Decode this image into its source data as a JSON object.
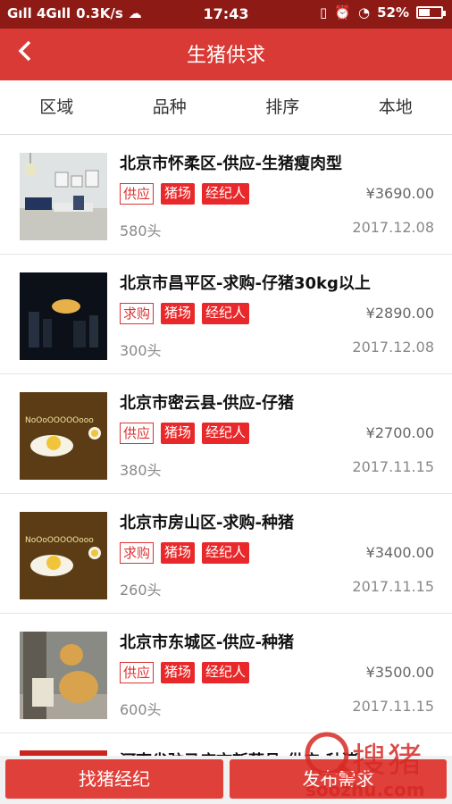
{
  "status_bar": {
    "carrier_left": "Gıll 4Gıll",
    "speed": "0.3K/s",
    "time": "17:43",
    "battery": "52%",
    "battery_level": 0.52
  },
  "header": {
    "back_icon": "chevron-left-icon",
    "title": "生猪供求"
  },
  "filters": [
    "区域",
    "品种",
    "排序",
    "本地"
  ],
  "listings": [
    {
      "title": "北京市怀柔区-供应-生猪瘦肉型",
      "tags": [
        "供应",
        "猪场",
        "经纪人"
      ],
      "price": "¥3690.00",
      "count": "580头",
      "date": "2017.12.08",
      "thumb": "living-room-photo"
    },
    {
      "title": "北京市昌平区-求购-仔猪30kg以上",
      "tags": [
        "求购",
        "猪场",
        "经纪人"
      ],
      "price": "¥2890.00",
      "count": "300头",
      "date": "2017.12.08",
      "thumb": "night-moon-photo"
    },
    {
      "title": "北京市密云县-供应-仔猪",
      "tags": [
        "供应",
        "猪场",
        "经纪人"
      ],
      "price": "¥2700.00",
      "count": "380头",
      "date": "2017.11.15",
      "thumb": "egg-cartoon"
    },
    {
      "title": "北京市房山区-求购-种猪",
      "tags": [
        "求购",
        "猪场",
        "经纪人"
      ],
      "price": "¥3400.00",
      "count": "260头",
      "date": "2017.11.15",
      "thumb": "egg-cartoon"
    },
    {
      "title": "北京市东城区-供应-种猪",
      "tags": [
        "供应",
        "猪场",
        "经纪人"
      ],
      "price": "¥3500.00",
      "count": "600头",
      "date": "2017.11.15",
      "thumb": "dog-photo"
    }
  ],
  "partial_listing_title": "河南省驻马店市新蔡县-供应-种猪",
  "egg_text": "NoOoOOOOOooo",
  "bottom": {
    "left_button": "找猪经纪",
    "right_button": "发布需求"
  },
  "watermark": {
    "brand": "搜猪",
    "url": "soozhu.com"
  },
  "colors": {
    "header": "#d93a35",
    "status": "#8e1a16",
    "tag": "#e8282a",
    "button": "#e0403a"
  }
}
